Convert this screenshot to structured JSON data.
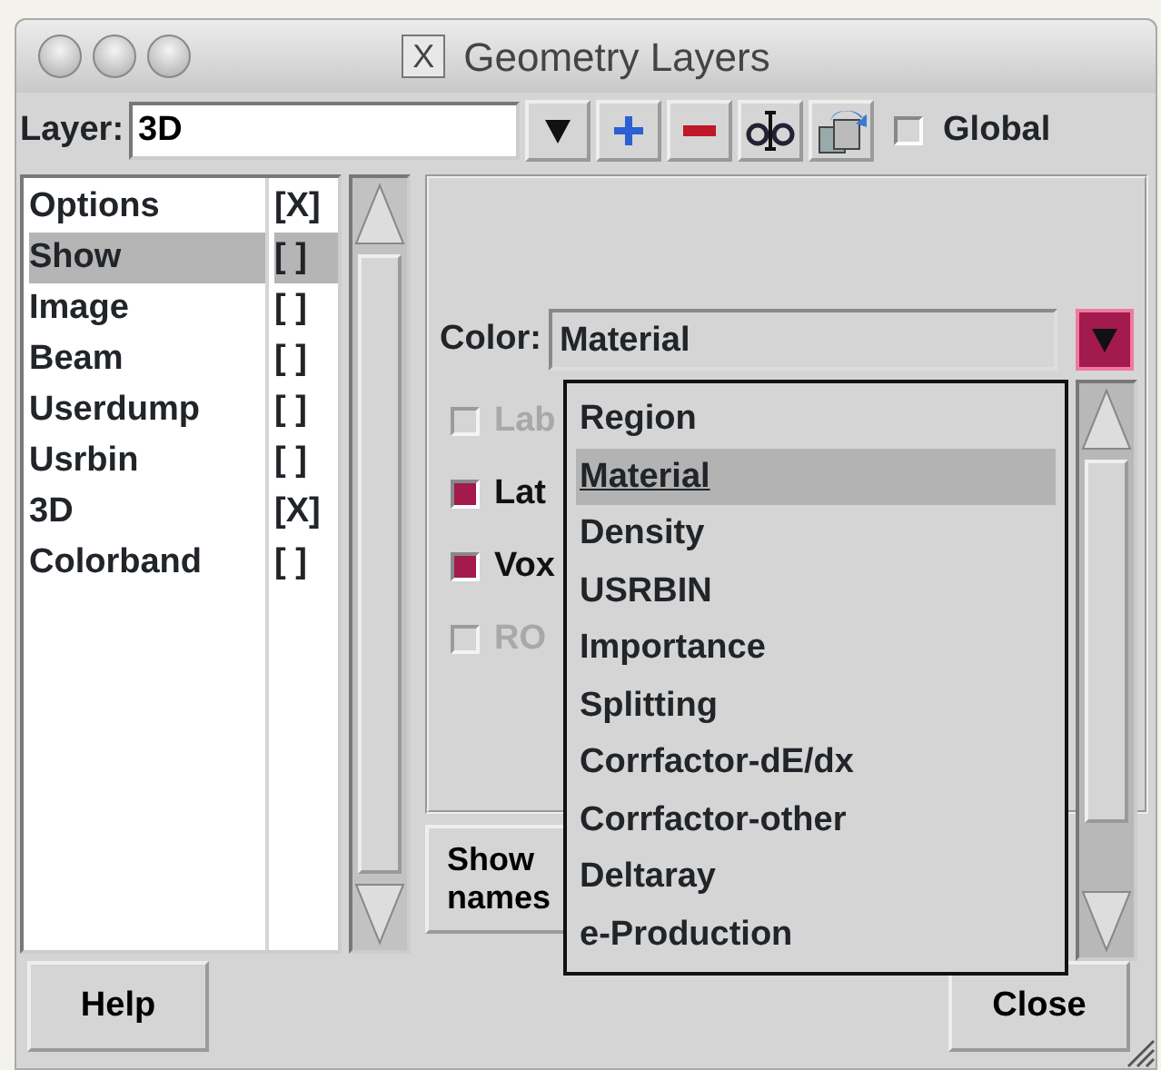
{
  "window": {
    "title": "Geometry Layers",
    "title_icon": "X"
  },
  "toolbar": {
    "label": "Layer:",
    "value": "3D",
    "global": {
      "label": "Global",
      "checked": false
    }
  },
  "layers": [
    {
      "name": "Options",
      "flag": "[X]",
      "selected": false
    },
    {
      "name": "Show",
      "flag": "[ ]",
      "selected": true
    },
    {
      "name": "Image",
      "flag": "[ ]",
      "selected": false
    },
    {
      "name": "Beam",
      "flag": "[ ]",
      "selected": false
    },
    {
      "name": "Userdump",
      "flag": "[ ]",
      "selected": false
    },
    {
      "name": "Usrbin",
      "flag": "[ ]",
      "selected": false
    },
    {
      "name": "3D",
      "flag": "[X]",
      "selected": false
    },
    {
      "name": "Colorband",
      "flag": "[ ]",
      "selected": false
    }
  ],
  "color": {
    "label": "Color:",
    "value": "Material",
    "expanded": true
  },
  "options": [
    {
      "label": "Lab",
      "checked": false,
      "disabled": true
    },
    {
      "label": "Lat",
      "checked": true,
      "disabled": false
    },
    {
      "label": "Vox",
      "checked": true,
      "disabled": false
    },
    {
      "label": "RO",
      "checked": false,
      "disabled": true
    }
  ],
  "show_button": {
    "lines": [
      "Show",
      "names"
    ]
  },
  "dropdown": [
    {
      "label": "Region",
      "selected": false
    },
    {
      "label": "Material",
      "selected": true
    },
    {
      "label": "Density",
      "selected": false
    },
    {
      "label": "USRBIN",
      "selected": false
    },
    {
      "label": "Importance",
      "selected": false
    },
    {
      "label": "Splitting",
      "selected": false
    },
    {
      "label": "Corrfactor-dE/dx",
      "selected": false
    },
    {
      "label": "Corrfactor-other",
      "selected": false
    },
    {
      "label": "Deltaray",
      "selected": false
    },
    {
      "label": "e-Production",
      "selected": false
    }
  ],
  "buttons": [
    {
      "label": "Help"
    },
    {
      "label": "Close"
    }
  ]
}
